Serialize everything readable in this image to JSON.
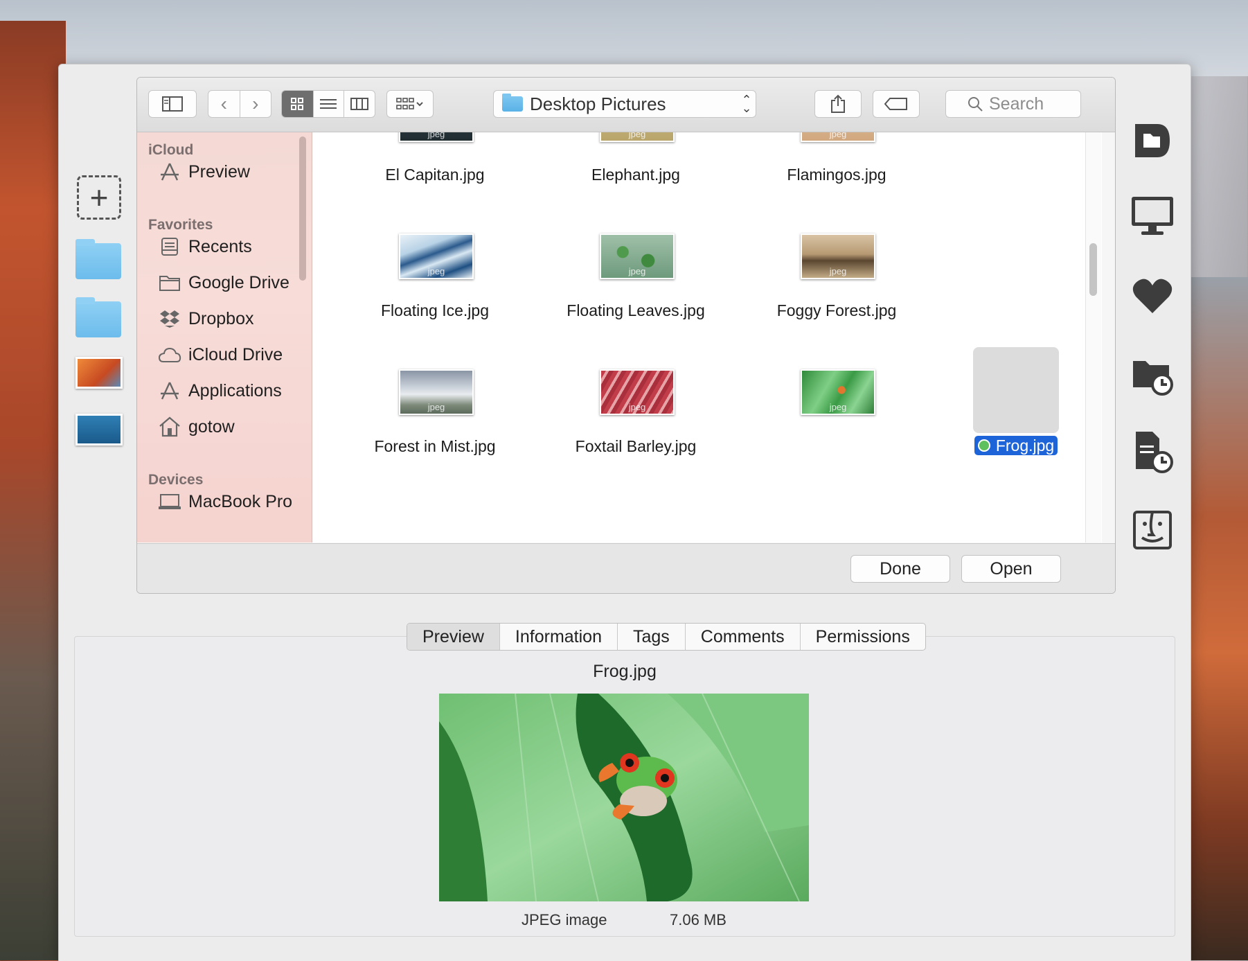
{
  "dialog": {
    "path": "Desktop Pictures",
    "search_placeholder": "Search"
  },
  "sidebar": {
    "sections": [
      {
        "title": "iCloud",
        "items": [
          {
            "label": "Preview",
            "icon": "app-store-icon"
          }
        ]
      },
      {
        "title": "Favorites",
        "items": [
          {
            "label": "Recents",
            "icon": "recents-icon"
          },
          {
            "label": "Google Drive",
            "icon": "folder-icon"
          },
          {
            "label": "Dropbox",
            "icon": "dropbox-icon"
          },
          {
            "label": "iCloud Drive",
            "icon": "cloud-icon"
          },
          {
            "label": "Applications",
            "icon": "applications-icon"
          },
          {
            "label": "gotow",
            "icon": "home-icon"
          }
        ]
      },
      {
        "title": "Devices",
        "items": [
          {
            "label": "MacBook Pro",
            "icon": "laptop-icon"
          }
        ]
      }
    ]
  },
  "files": [
    {
      "name": "El Capitan.jpg",
      "thumb_label": "jpeg"
    },
    {
      "name": "Elephant.jpg",
      "thumb_label": "jpeg"
    },
    {
      "name": "Flamingos.jpg",
      "thumb_label": "jpeg"
    },
    {
      "name": "Floating Ice.jpg",
      "thumb_label": "jpeg"
    },
    {
      "name": "Floating Leaves.jpg",
      "thumb_label": "jpeg"
    },
    {
      "name": "Foggy Forest.jpg",
      "thumb_label": "jpeg"
    },
    {
      "name": "Forest in Mist.jpg",
      "thumb_label": "jpeg"
    },
    {
      "name": "Foxtail Barley.jpg",
      "thumb_label": "jpeg"
    },
    {
      "name": "Frog.jpg",
      "thumb_label": "jpeg",
      "selected": true
    }
  ],
  "buttons": {
    "done": "Done",
    "open": "Open"
  },
  "inspector": {
    "tabs": [
      "Preview",
      "Information",
      "Tags",
      "Comments",
      "Permissions"
    ],
    "active_tab": "Preview",
    "file_name": "Frog.jpg",
    "kind": "JPEG image",
    "size": "7.06 MB"
  },
  "colors": {
    "selection": "#1d64d9",
    "tag_green": "#5ec05e"
  }
}
